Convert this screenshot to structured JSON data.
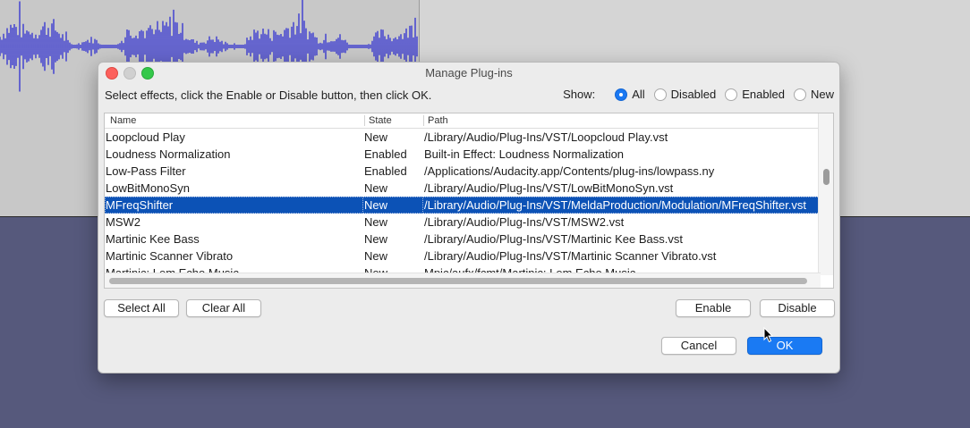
{
  "dialog": {
    "title": "Manage Plug-ins",
    "instructions": "Select effects, click the Enable or Disable button, then click OK.",
    "show": {
      "label": "Show:",
      "options": [
        {
          "label": "All",
          "selected": true
        },
        {
          "label": "Disabled",
          "selected": false
        },
        {
          "label": "Enabled",
          "selected": false
        },
        {
          "label": "New",
          "selected": false
        }
      ]
    },
    "table": {
      "headers": [
        "Name",
        "State",
        "Path"
      ],
      "rows": [
        {
          "name": "Loopcloud Play",
          "state": "New",
          "path": "/Library/Audio/Plug-Ins/VST/Loopcloud Play.vst"
        },
        {
          "name": "Loudness Normalization",
          "state": "Enabled",
          "path": "Built-in Effect: Loudness Normalization"
        },
        {
          "name": "Low-Pass Filter",
          "state": "Enabled",
          "path": "/Applications/Audacity.app/Contents/plug-ins/lowpass.ny"
        },
        {
          "name": "LowBitMonoSyn",
          "state": "New",
          "path": "/Library/Audio/Plug-Ins/VST/LowBitMonoSyn.vst"
        },
        {
          "name": "MFreqShifter",
          "state": "New",
          "path": "/Library/Audio/Plug-Ins/VST/MeldaProduction/Modulation/MFreqShifter.vst",
          "selected": true
        },
        {
          "name": "MSW2",
          "state": "New",
          "path": "/Library/Audio/Plug-Ins/VST/MSW2.vst"
        },
        {
          "name": "Martinic Kee Bass",
          "state": "New",
          "path": "/Library/Audio/Plug-Ins/VST/Martinic Kee Bass.vst"
        },
        {
          "name": "Martinic Scanner Vibrato",
          "state": "New",
          "path": "/Library/Audio/Plug-Ins/VST/Martinic Scanner Vibrato.vst"
        },
        {
          "name": "Martinic: Lem Echo Music",
          "state": "New",
          "path": "Mpic/aufx/fcmt/Martinic: Lem Echo Music"
        }
      ]
    },
    "buttons": {
      "select_all": "Select All",
      "clear_all": "Clear All",
      "enable": "Enable",
      "disable": "Disable",
      "cancel": "Cancel",
      "ok": "OK"
    }
  },
  "colors": {
    "selection": "#0c52b6",
    "accent": "#1a7af3",
    "waveform": "#3b3bd0"
  }
}
